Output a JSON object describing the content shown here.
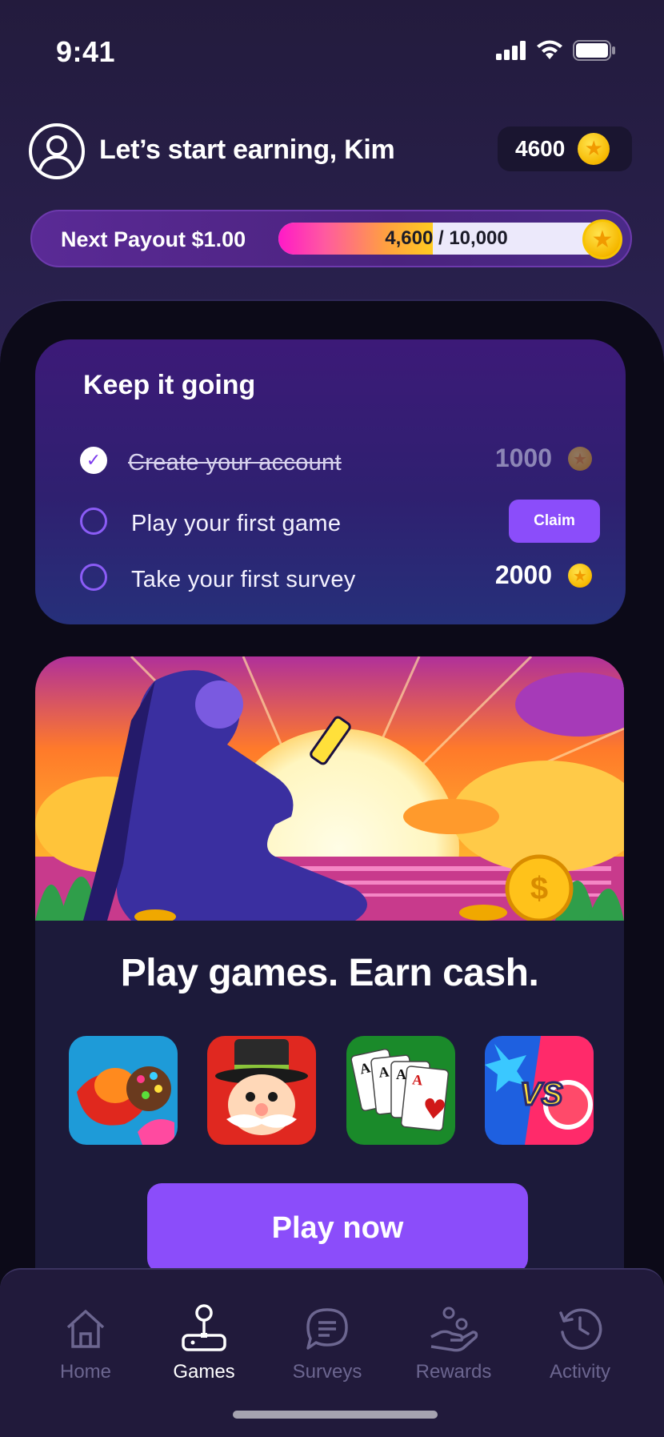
{
  "status_bar": {
    "time": "9:41"
  },
  "header": {
    "greeting": "Let’s start earning, Kim",
    "coin_balance": "4600"
  },
  "payout": {
    "label": "Next Payout $1.00",
    "progress_text": "4,600 / 10,000",
    "progress_value": 4600,
    "progress_max": 10000
  },
  "tasks": {
    "title": "Keep it going",
    "items": [
      {
        "label": "Create your account",
        "status": "completed",
        "reward": "1000"
      },
      {
        "label": "Play your first game",
        "status": "claimable",
        "action": "Claim"
      },
      {
        "label": "Take your first survey",
        "status": "pending",
        "reward": "2000"
      }
    ]
  },
  "games": {
    "title": "Play games. Earn cash.",
    "icons": [
      "candy-game-icon",
      "tycoon-game-icon",
      "solitaire-game-icon",
      "versus-game-icon"
    ],
    "cta": "Play now"
  },
  "nav": {
    "items": [
      {
        "label": "Home",
        "icon": "home-icon"
      },
      {
        "label": "Games",
        "icon": "joystick-icon",
        "active": true
      },
      {
        "label": "Surveys",
        "icon": "chat-icon"
      },
      {
        "label": "Rewards",
        "icon": "rewards-icon"
      },
      {
        "label": "Activity",
        "icon": "history-icon"
      }
    ]
  },
  "colors": {
    "accent": "#8b4dfa",
    "coin": "#f6b800",
    "background": "#241c3f"
  }
}
